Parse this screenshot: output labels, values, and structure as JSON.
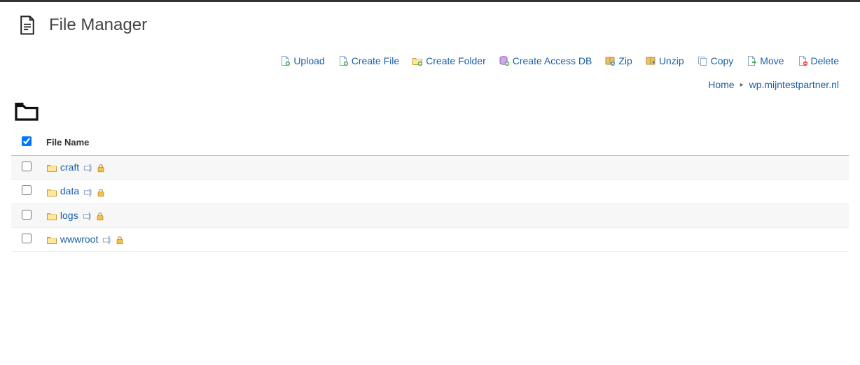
{
  "header": {
    "title": "File Manager"
  },
  "toolbar": {
    "upload": "Upload",
    "create_file": "Create File",
    "create_folder": "Create Folder",
    "create_access_db": "Create Access DB",
    "zip": "Zip",
    "unzip": "Unzip",
    "copy": "Copy",
    "move": "Move",
    "delete": "Delete"
  },
  "breadcrumb": {
    "home": "Home",
    "current": "wp.mijntestpartner.nl"
  },
  "table": {
    "header_filename": "File Name",
    "rows": [
      {
        "name": "craft"
      },
      {
        "name": "data"
      },
      {
        "name": "logs"
      },
      {
        "name": "wwwroot"
      }
    ]
  }
}
